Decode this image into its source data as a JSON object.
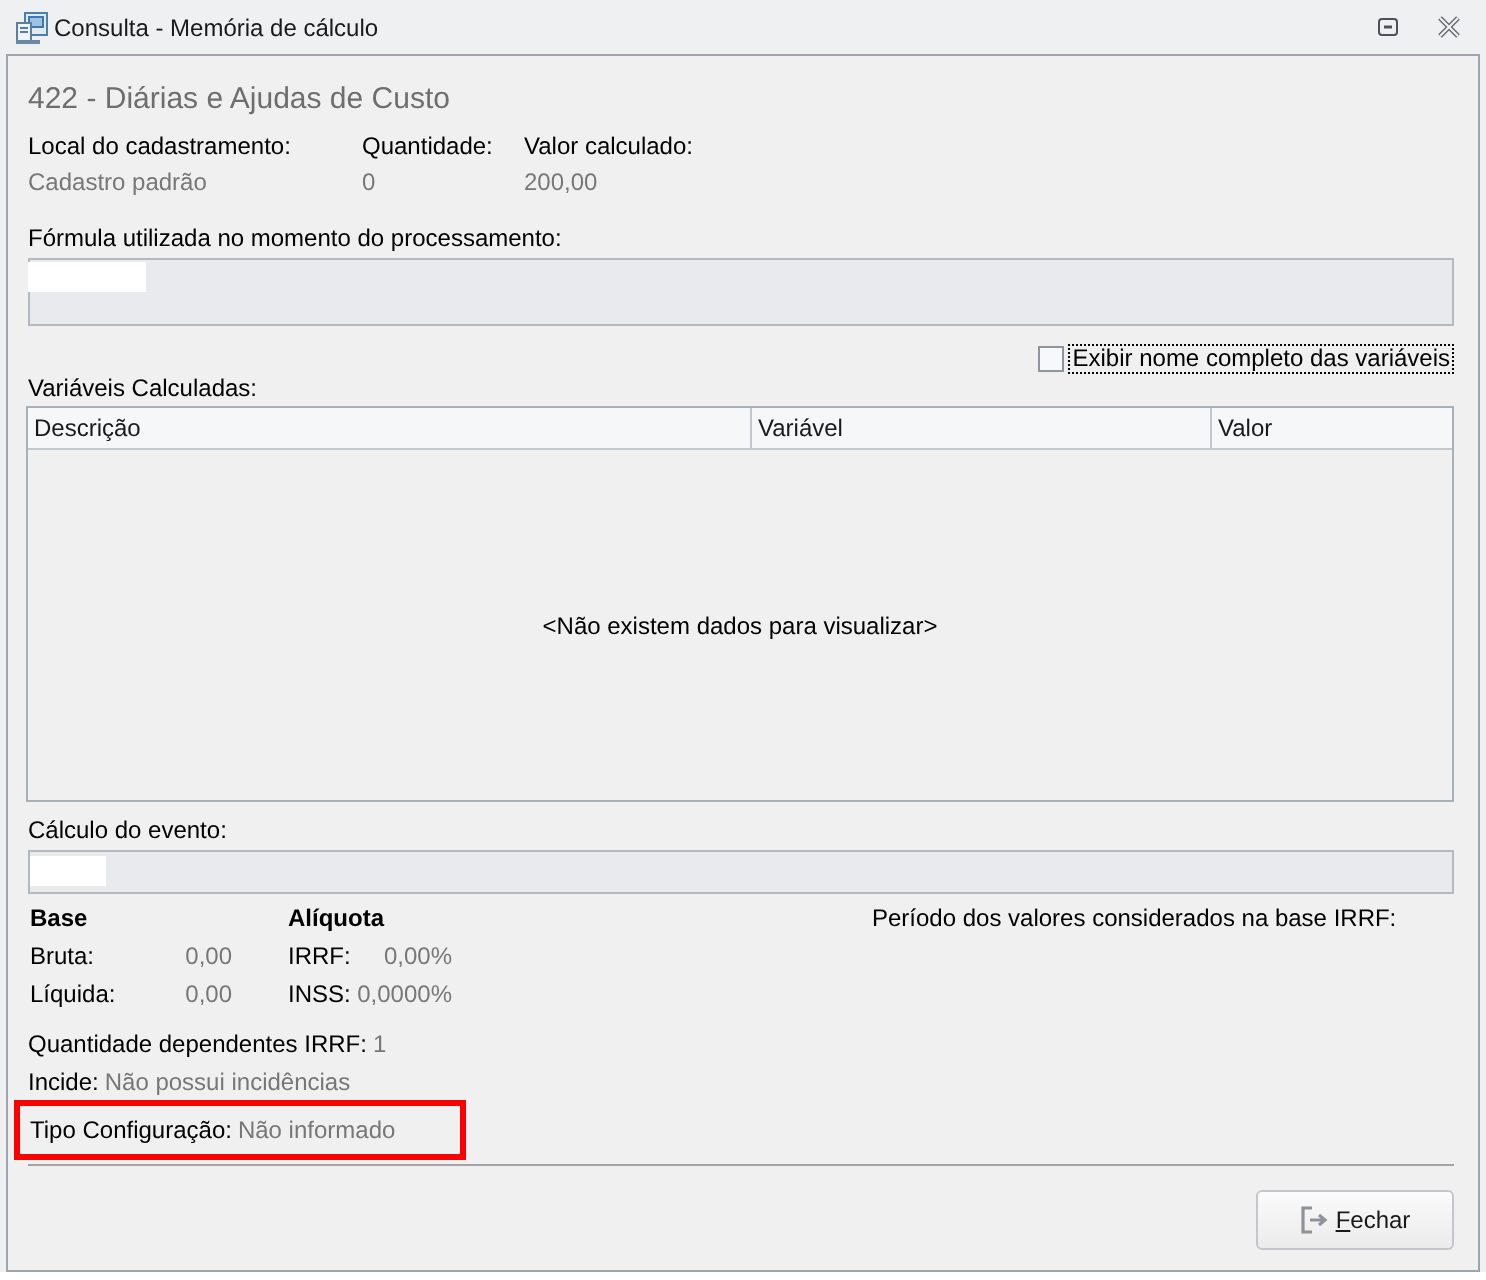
{
  "window": {
    "title": "Consulta - Memória de cálculo"
  },
  "heading": "422 - Diárias e Ajudas de Custo",
  "summary": [
    {
      "label": "Local do cadastramento:",
      "value": "Cadastro padrão"
    },
    {
      "label": "Quantidade:",
      "value": "0"
    },
    {
      "label": "Valor calculado:",
      "value": "200,00"
    }
  ],
  "formula": {
    "label": "Fórmula utilizada no momento do processamento:"
  },
  "full_names_checkbox": {
    "label": "Exibir nome completo das variáveis",
    "checked": false
  },
  "variables": {
    "label": "Variáveis Calculadas:",
    "columns": [
      "Descrição",
      "Variável",
      "Valor"
    ],
    "empty_message": "<Não existem dados para visualizar>"
  },
  "event_calculation": {
    "label": "Cálculo do evento:"
  },
  "base": {
    "title": "Base",
    "rows": [
      {
        "label": "Bruta:",
        "value": "0,00"
      },
      {
        "label": "Líquida:",
        "value": "0,00"
      }
    ]
  },
  "rate": {
    "title": "Alíquota",
    "rows": [
      {
        "label": "IRRF:",
        "value": "0,00%"
      },
      {
        "label": "INSS:",
        "value": "0,0000%"
      }
    ]
  },
  "irrf_period": {
    "label": "Período dos valores considerados na base IRRF:"
  },
  "details": [
    {
      "label": "Quantidade dependentes IRRF:",
      "value": "1",
      "highlighted": false
    },
    {
      "label": "Incide:",
      "value": "Não possui incidências",
      "highlighted": false
    },
    {
      "label": "Tipo Configuração:",
      "value": "Não informado",
      "highlighted": true
    }
  ],
  "buttons": [
    {
      "label": "Fechar",
      "mnemonic": true
    }
  ]
}
